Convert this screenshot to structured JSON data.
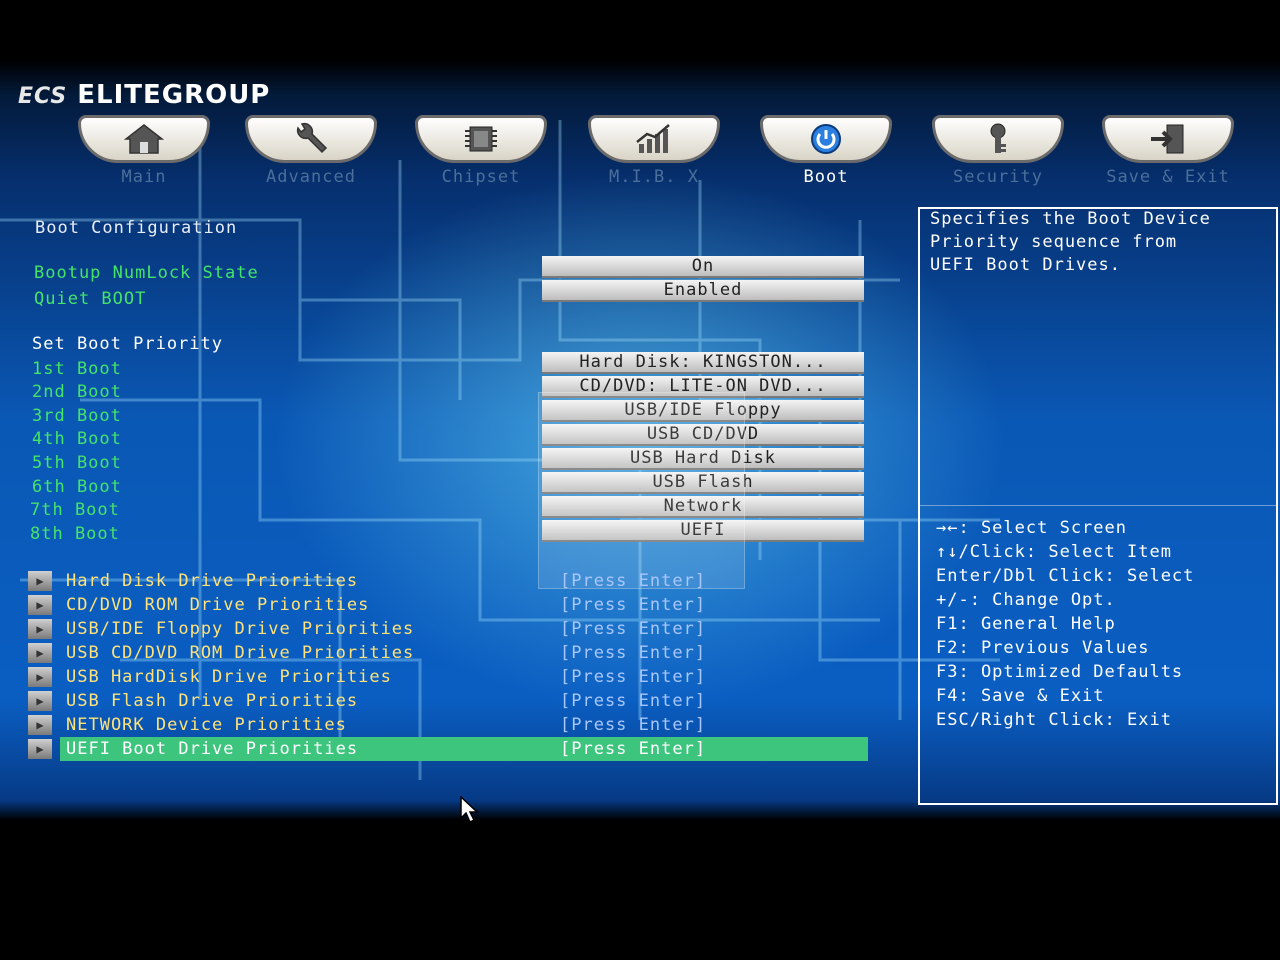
{
  "brand": {
    "name": "ELITEGROUP",
    "mark": "ECS"
  },
  "tabs": [
    {
      "label": "Main",
      "icon": "home-icon",
      "active": false
    },
    {
      "label": "Advanced",
      "icon": "wrench-icon",
      "active": false
    },
    {
      "label": "Chipset",
      "icon": "chip-icon",
      "active": false
    },
    {
      "label": "M.I.B. X",
      "icon": "chart-icon",
      "active": false
    },
    {
      "label": "Boot",
      "icon": "power-icon",
      "active": true
    },
    {
      "label": "Security",
      "icon": "key-icon",
      "active": false
    },
    {
      "label": "Save & Exit",
      "icon": "exit-icon",
      "active": false
    }
  ],
  "boot_config": {
    "title": "Boot Configuration",
    "numlock_label": "Bootup NumLock State",
    "numlock_value": "On",
    "quiet_label": "Quiet BOOT",
    "quiet_value": "Enabled"
  },
  "priority": {
    "title": "Set Boot Priority",
    "items": [
      {
        "label": "1st Boot",
        "value": "Hard Disk: KINGSTON..."
      },
      {
        "label": "2nd Boot",
        "value": "CD/DVD: LITE-ON DVD..."
      },
      {
        "label": "3rd Boot",
        "value": "USB/IDE Floppy"
      },
      {
        "label": "4th Boot",
        "value": "USB CD/DVD"
      },
      {
        "label": "5th Boot",
        "value": "USB Hard Disk"
      },
      {
        "label": "6th Boot",
        "value": "USB Flash"
      },
      {
        "label": "7th Boot",
        "value": "Network"
      },
      {
        "label": "8th Boot",
        "value": "UEFI"
      }
    ]
  },
  "submenus": [
    {
      "label": "Hard Disk Drive Priorities",
      "action": "[Press Enter]"
    },
    {
      "label": "CD/DVD ROM Drive Priorities",
      "action": "[Press Enter]"
    },
    {
      "label": "USB/IDE Floppy Drive Priorities",
      "action": "[Press Enter]"
    },
    {
      "label": "USB CD/DVD ROM Drive Priorities",
      "action": "[Press Enter]"
    },
    {
      "label": "USB HardDisk Drive Priorities",
      "action": "[Press Enter]"
    },
    {
      "label": "USB Flash Drive Priorities",
      "action": "[Press Enter]"
    },
    {
      "label": "NETWORK Device Priorities",
      "action": "[Press Enter]"
    },
    {
      "label": "UEFI Boot Drive Priorities",
      "action": "[Press Enter]"
    }
  ],
  "help": {
    "description": [
      "Specifies the Boot Device",
      "Priority sequence from",
      "UEFI Boot Drives."
    ],
    "keys": [
      "→←: Select Screen",
      "↑↓/Click: Select Item",
      "Enter/Dbl Click: Select",
      "+/-: Change Opt.",
      "F1: General Help",
      "F2: Previous Values",
      "F3: Optimized Defaults",
      "F4: Save & Exit",
      "ESC/Right Click: Exit"
    ]
  },
  "colors": {
    "label_green": "#44e36a",
    "submenu_yellow": "#ffe27a",
    "selection_green": "#3dc57e",
    "inactive_tab": "#4b6f9a"
  }
}
